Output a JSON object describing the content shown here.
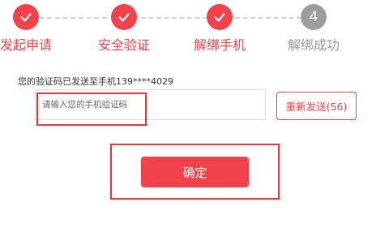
{
  "steps": [
    {
      "label": "发起申请",
      "status": "done",
      "icon": "check-icon"
    },
    {
      "label": "安全验证",
      "status": "done",
      "icon": "check-icon"
    },
    {
      "label": "解绑手机",
      "status": "done",
      "icon": "check-icon"
    },
    {
      "label": "解绑成功",
      "status": "pending",
      "number": "4"
    }
  ],
  "verification": {
    "hint": "您的验证码已发送至手机139****4029",
    "placeholder": "请输入您的手机验证码",
    "value": "",
    "resend_label": "重新发送(56)"
  },
  "confirm_label": "确定",
  "colors": {
    "accent": "#f2424b",
    "pending": "#9e9e9e",
    "highlight_box": "#e53935"
  }
}
